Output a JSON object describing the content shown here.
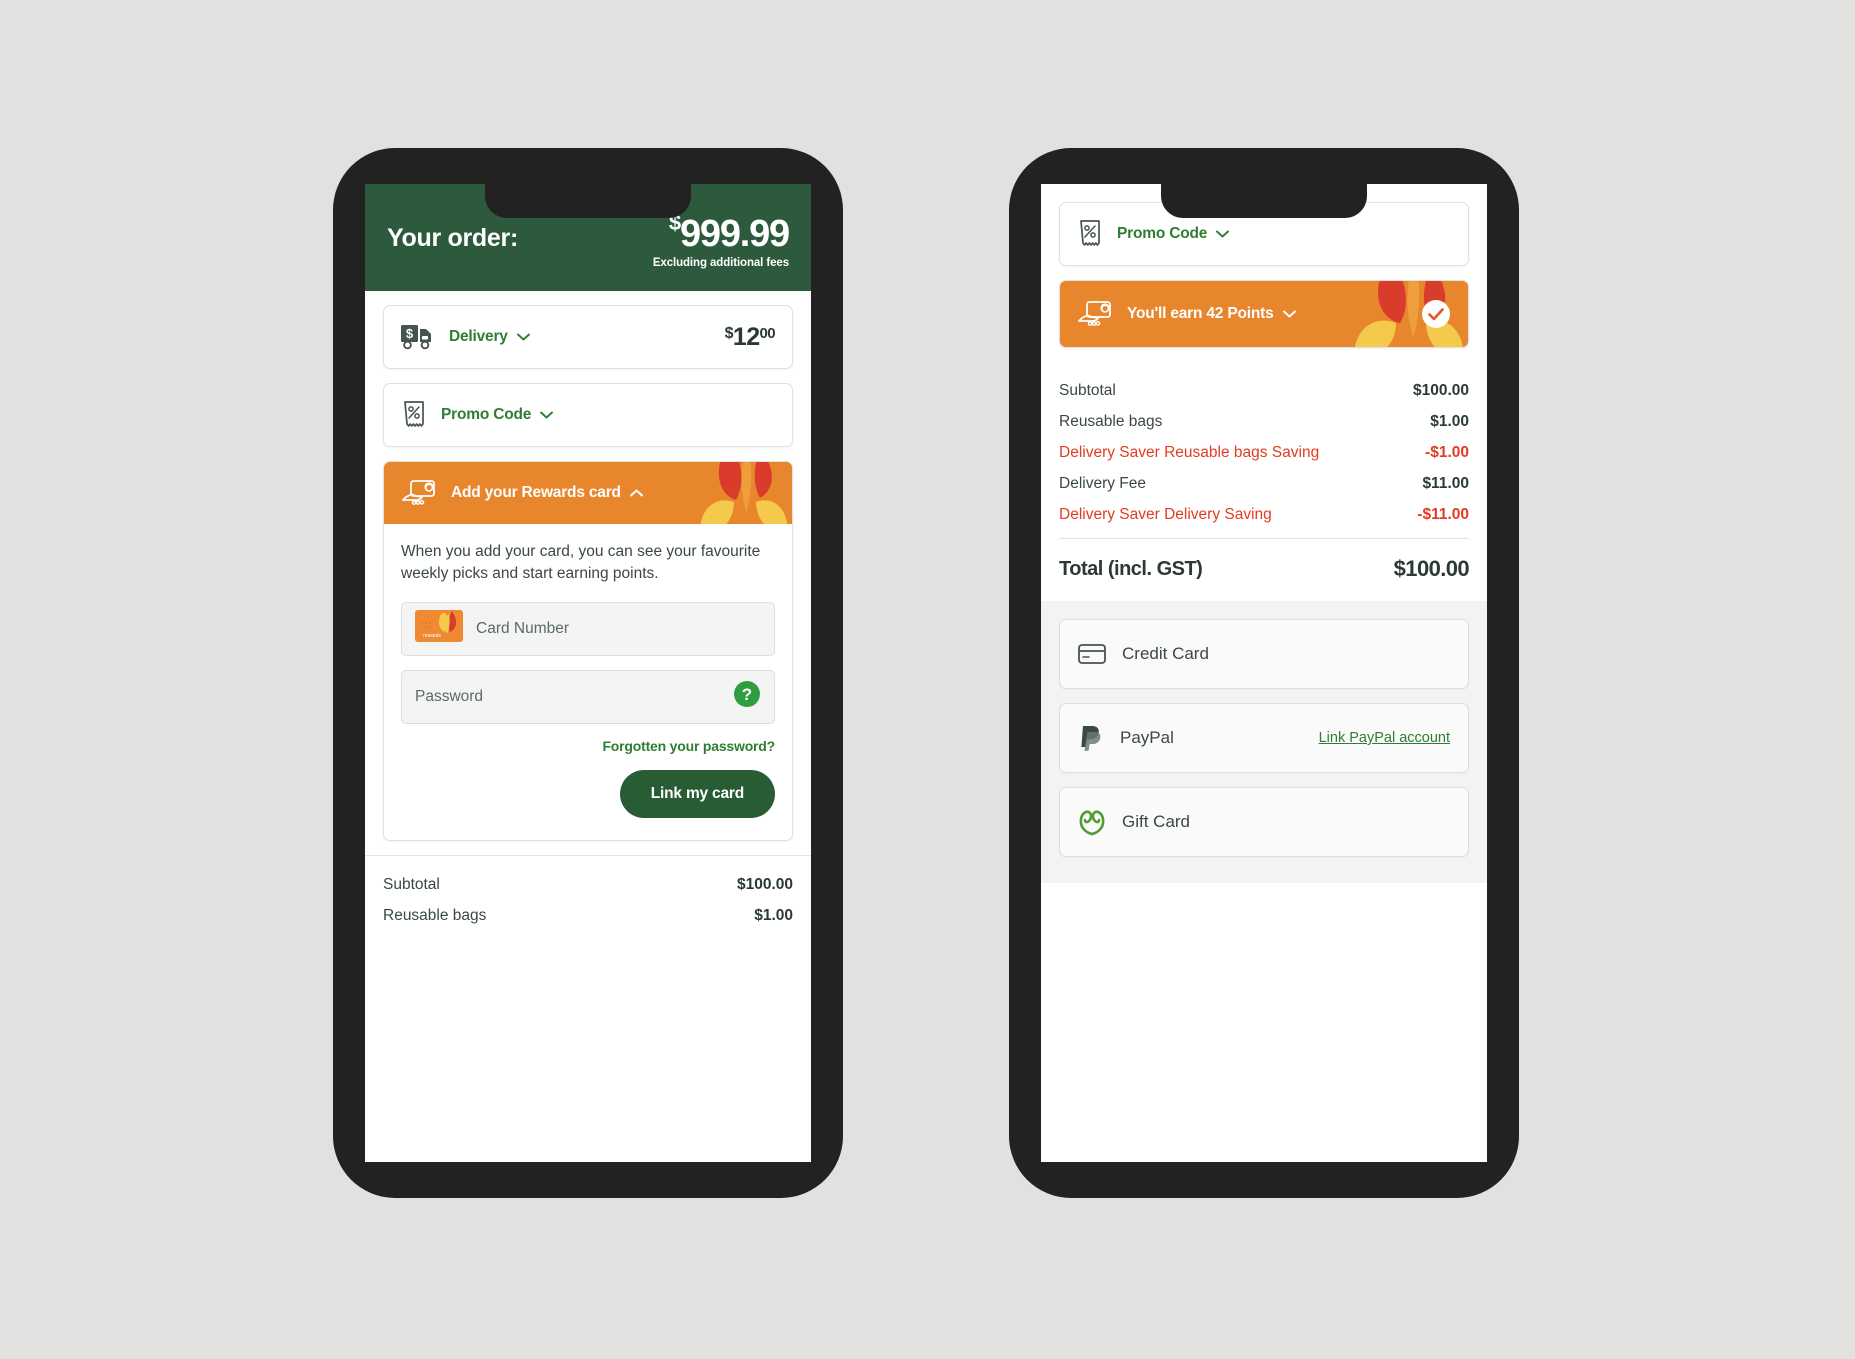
{
  "page": {
    "background_color": "#e2e1df",
    "brand_green": "#2f7d32",
    "header_green": "#2d5a3d",
    "brand_orange": "#e8862e",
    "savings_red": "#e23b21"
  },
  "phone_left": {
    "order_header": {
      "title": "Your order:",
      "currency_symbol": "$",
      "amount": "999.99",
      "note": "Excluding additional fees"
    },
    "delivery_row": {
      "icon": "delivery-truck-icon",
      "label": "Delivery",
      "chevron": "chevron-down-icon",
      "currency_symbol": "$",
      "amount_dollars": "12",
      "amount_cents": "00"
    },
    "promo_row": {
      "icon": "promo-receipt-icon",
      "label": "Promo Code",
      "chevron": "chevron-down-icon"
    },
    "rewards": {
      "icon": "rewards-card-hand-icon",
      "header_label": "Add your Rewards card",
      "chevron": "chevron-up-icon",
      "description": "When you add your card, you can see your favourite weekly picks and start earning points.",
      "card_number_placeholder": "Card Number",
      "card_thumbnail_icon": "rewards-card-thumbnail",
      "password_placeholder": "Password",
      "help_icon": "help-question-icon",
      "forgot_link": "Forgotten your password?",
      "submit_label": "Link my card"
    },
    "summary_rows": [
      {
        "label": "Subtotal",
        "amount": "$100.00",
        "negative": false
      },
      {
        "label": "Reusable bags",
        "amount": "$1.00",
        "negative": false
      }
    ]
  },
  "phone_right": {
    "promo_row": {
      "icon": "promo-receipt-icon",
      "label": "Promo Code",
      "chevron": "chevron-down-icon"
    },
    "points_banner": {
      "icon": "rewards-card-hand-icon",
      "label_prefix": "You'll earn ",
      "points": "42",
      "label_suffix": " Points",
      "chevron": "chevron-down-icon",
      "check_icon": "check-circle-icon"
    },
    "summary_rows": [
      {
        "label": "Subtotal",
        "amount": "$100.00",
        "negative": false
      },
      {
        "label": "Reusable bags",
        "amount": "$1.00",
        "negative": false
      },
      {
        "label": "Delivery Saver Reusable bags Saving",
        "amount": "-$1.00",
        "negative": true
      },
      {
        "label": "Delivery Fee",
        "amount": "$11.00",
        "negative": false
      },
      {
        "label": "Delivery Saver Delivery Saving",
        "amount": "-$11.00",
        "negative": true
      }
    ],
    "total": {
      "label": "Total (incl. GST)",
      "amount": "$100.00"
    },
    "payment_methods": [
      {
        "icon": "credit-card-icon",
        "label": "Credit Card",
        "link": ""
      },
      {
        "icon": "paypal-icon",
        "label": "PayPal",
        "link": "Link PayPal account"
      },
      {
        "icon": "woolworths-logo-icon",
        "label": "Gift Card",
        "link": ""
      }
    ]
  }
}
